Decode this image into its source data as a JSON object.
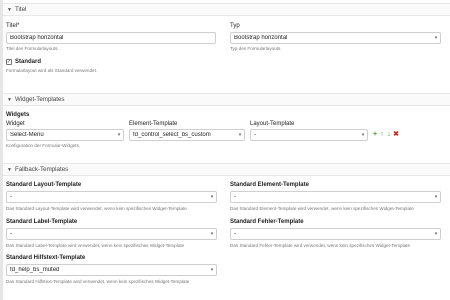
{
  "section_title": {
    "title": "Titel",
    "title_label": "Titel",
    "required_mark": "*",
    "title_value": "Bootstrap horizontal",
    "title_help": "Titel des Formularlayouts.",
    "type_label": "Typ",
    "type_value": "Bootstrap horizontal",
    "type_help": "Typ des Formularlayouts.",
    "standard_label": "Standard",
    "standard_checked": true,
    "standard_help": "Formularlayout wird als Standard verwendet."
  },
  "section_widgets": {
    "title": "Widget-Templates",
    "widgets_label": "Widgets",
    "col_widget": "Widget",
    "col_element": "Element-Template",
    "col_layout": "Layout-Template",
    "row": {
      "widget": "Select-Menü",
      "element": "fd_control_select_bs_custom",
      "layout": "-"
    },
    "help": "Konfiguration der Formular-Widgets."
  },
  "section_fallback": {
    "title": "Fallback-Templates",
    "layout_label": "Standard Layout-Template",
    "layout_value": "-",
    "layout_help": "Das Standard Layout-Template wird verwendet, wenn kein spezifisches Widget-Template",
    "element_label": "Standard Element-Template",
    "element_value": "-",
    "element_help": "Das Standard Element-Template wird verwendet, wenn kein spezifisches Widget-Template",
    "label_label": "Standard Label-Template",
    "label_value": "-",
    "label_help": "Das Standard Label-Template wird verwendet, wenn kein spezifisches Widget-Template",
    "error_label": "Standard Fehler-Template",
    "error_value": "-",
    "error_help": "Das Standard Fehler-Template wird verwendet, wenn kein spezifisches Widget-Template",
    "helptext_label": "Standard Hilfstext-Template",
    "helptext_value": "fd_help_bs_muted",
    "helptext_help": "Das Standard Hilfstext-Template wird verwendet, wenn kein spezifisches Widget-Template"
  },
  "icons": {
    "collapse": "triangle-down",
    "dropdown": "chevron-down",
    "add": "plus",
    "move_up": "arrow-up",
    "move_down": "arrow-down",
    "remove": "x"
  },
  "colors": {
    "add": "#4a9e2f",
    "remove": "#c53030"
  }
}
